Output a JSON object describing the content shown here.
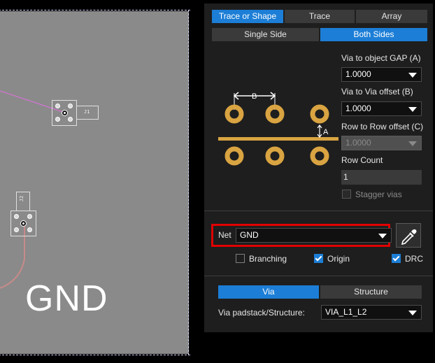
{
  "canvas": {
    "net_label": "GND",
    "components": [
      {
        "ref": "J1"
      },
      {
        "ref": "J2"
      }
    ]
  },
  "panel": {
    "mode_tabs": [
      {
        "label": "Trace or Shape",
        "active": true
      },
      {
        "label": "Trace",
        "active": false
      },
      {
        "label": "Array",
        "active": false
      }
    ],
    "side_tabs": [
      {
        "label": "Single Side",
        "active": false
      },
      {
        "label": "Both Sides",
        "active": true
      }
    ],
    "diagram": {
      "label_b": "B",
      "label_a": "A"
    },
    "via_gap": {
      "label": "Via to object GAP (A)",
      "value": "1.0000"
    },
    "via_offset": {
      "label": "Via to Via offset (B)",
      "value": "1.0000"
    },
    "row_offset": {
      "label": "Row to Row offset (C)",
      "value": "1.0000",
      "disabled": true
    },
    "row_count": {
      "label": "Row Count",
      "value": "1"
    },
    "stagger": {
      "label": "Stagger vias",
      "checked": false,
      "disabled": true
    },
    "net": {
      "label": "Net",
      "value": "GND"
    },
    "options": [
      {
        "label": "Branching",
        "checked": false
      },
      {
        "label": "Origin",
        "checked": true
      },
      {
        "label": "DRC",
        "checked": true
      }
    ],
    "type_tabs": [
      {
        "label": "Via",
        "active": true
      },
      {
        "label": "Structure",
        "active": false
      }
    ],
    "padstack": {
      "label": "Via padstack/Structure:",
      "value": "VIA_L1_L2"
    }
  },
  "colors": {
    "accent": "#1c7ed6",
    "board": "#8a8a8a",
    "highlight": "#e10000",
    "copper": "#d9a441",
    "trace_magenta": "#e070e0",
    "trace_red": "#c88a8a"
  }
}
